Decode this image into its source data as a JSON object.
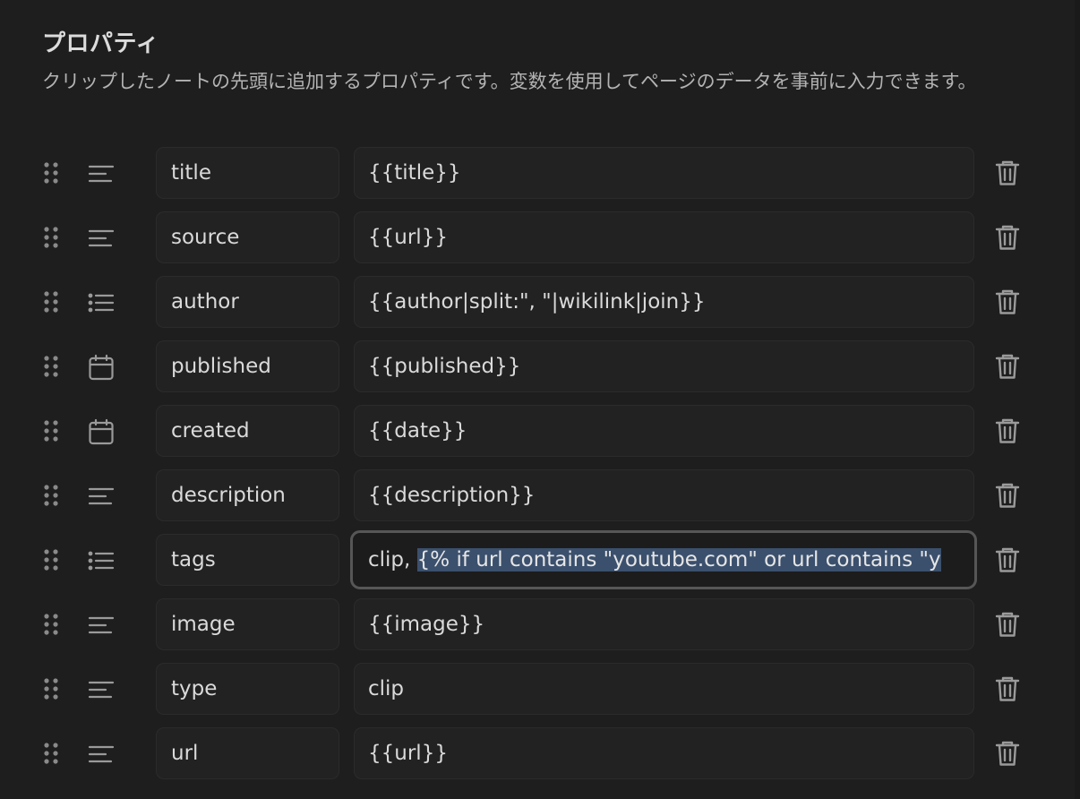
{
  "section": {
    "title": "プロパティ",
    "description": "クリップしたノートの先頭に追加するプロパティです。変数を使用してページのデータを事前に入力できます。"
  },
  "properties": [
    {
      "type_icon": "text-icon",
      "name": "title",
      "value": "{{title}}"
    },
    {
      "type_icon": "text-icon",
      "name": "source",
      "value": "{{url}}"
    },
    {
      "type_icon": "list-icon",
      "name": "author",
      "value": "{{author|split:\", \"|wikilink|join}}"
    },
    {
      "type_icon": "calendar-icon",
      "name": "published",
      "value": "{{published}}"
    },
    {
      "type_icon": "calendar-icon",
      "name": "created",
      "value": "{{date}}"
    },
    {
      "type_icon": "text-icon",
      "name": "description",
      "value": "{{description}}"
    },
    {
      "type_icon": "list-icon",
      "name": "tags",
      "value_prefix": "clip, ",
      "value_selected": "{% if url contains \"youtube.com\" or url contains \"y",
      "focused": true
    },
    {
      "type_icon": "text-icon",
      "name": "image",
      "value": "{{image}}"
    },
    {
      "type_icon": "text-icon",
      "name": "type",
      "value": "clip"
    },
    {
      "type_icon": "text-icon",
      "name": "url",
      "value": "{{url}}"
    }
  ],
  "colors": {
    "background": "#1e1e1e",
    "field_background": "#222222",
    "field_border": "#2b2b2b",
    "focus_border": "#565656",
    "selection": "#3b506d",
    "icon": "#9a9a9a",
    "text": "#dadada",
    "muted_text": "#b3b3b3"
  }
}
